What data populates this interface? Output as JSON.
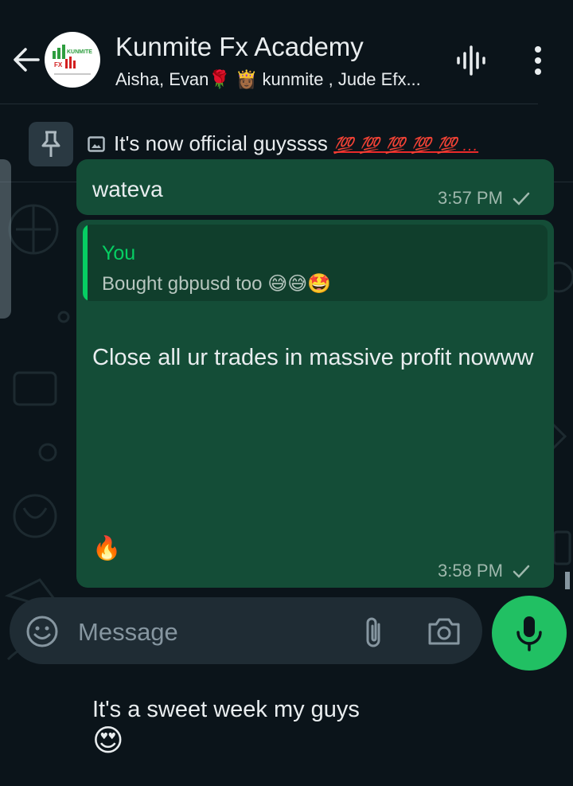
{
  "header": {
    "back_icon": "arrow-left-icon",
    "avatar_logo_text": "KUNMITE FX",
    "title": "Kunmite Fx Academy",
    "subtitle_part1": "Aisha, Evan",
    "subtitle_part2": "kunmite , Jude Efx...",
    "voice_icon": "audio-waveform-icon",
    "menu_icon": "more-vertical-icon"
  },
  "pinned": {
    "pin_icon": "pin-icon",
    "image_icon": "image-icon",
    "text": "It's now official guyssss",
    "emojis": "💯 💯 💯 💯 💯 ...",
    "emoji_color": "#ea2a2a"
  },
  "messages": [
    {
      "text": "wateva",
      "time": "3:57 PM",
      "status": "sent"
    },
    {
      "quote": {
        "author": "You",
        "text": "Bought gbpusd too"
      },
      "text_line1": "Close all ur trades in massive profit nowww",
      "fire": "🔥",
      "text_line2": "It's a sweet week my guys",
      "time": "3:58 PM",
      "status": "sent"
    }
  ],
  "input": {
    "placeholder": "Message",
    "emoji_icon": "smiley-icon",
    "attach_icon": "paperclip-icon",
    "camera_icon": "camera-icon",
    "mic_icon": "microphone-icon"
  },
  "colors": {
    "background": "#0b141a",
    "outgoing_bubble": "#144d37",
    "accent": "#21c063",
    "quote_author": "#06cf63"
  }
}
